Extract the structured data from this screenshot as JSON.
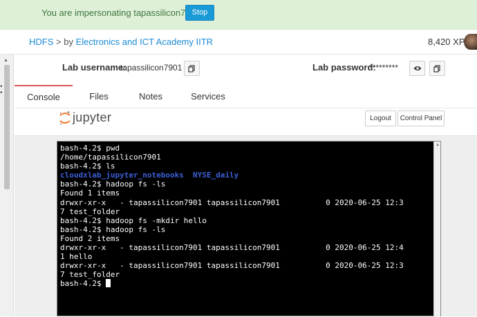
{
  "banner": {
    "text": "You are impersonating tapassilicon7901",
    "stop_label": "Stop"
  },
  "breadcrumb": {
    "root": "HDFS",
    "separator": ">",
    "by": "by",
    "author": "Electronics and ICT Academy IITR"
  },
  "user": {
    "xp": "8,420 XP"
  },
  "credentials": {
    "username_label": "Lab username:",
    "username_value": "tapassilicon7901",
    "password_label": "Lab password:",
    "password_value": "*********"
  },
  "tabs": [
    {
      "label": "Console",
      "active": true
    },
    {
      "label": "Files",
      "active": false
    },
    {
      "label": "Notes",
      "active": false
    },
    {
      "label": "Services",
      "active": false
    }
  ],
  "jupyter": {
    "brand": "jupyter",
    "logout_label": "Logout",
    "control_panel_label": "Control Panel"
  },
  "terminal": {
    "lines": [
      "bash-4.2$ pwd",
      "/home/tapassilicon7901",
      "bash-4.2$ ls",
      "cloudxlab_jupyter_notebooks  NYSE_daily",
      "bash-4.2$ hadoop fs -ls",
      "Found 1 items",
      "drwxr-xr-x   - tapassilicon7901 tapassilicon7901          0 2020-06-25 12:3",
      "7 test_folder",
      "bash-4.2$ hadoop fs -mkdir hello",
      "bash-4.2$ hadoop fs -ls",
      "Found 2 items",
      "drwxr-xr-x   - tapassilicon7901 tapassilicon7901          0 2020-06-25 12:4",
      "1 hello",
      "drwxr-xr-x   - tapassilicon7901 tapassilicon7901          0 2020-06-25 12:3",
      "7 test_folder",
      "bash-4.2$ "
    ],
    "highlight_line_index": 3,
    "highlight_color": "#3b5fd7"
  },
  "colors": {
    "banner_bg": "#dff0d8",
    "banner_text": "#3c763d",
    "accent_blue": "#1a9ad6",
    "active_tab": "#d9534f",
    "jupyter_orange": "#f37726"
  }
}
